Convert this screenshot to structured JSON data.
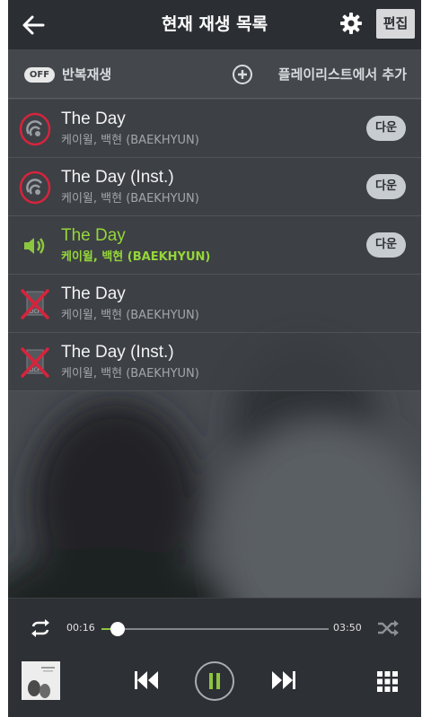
{
  "header": {
    "title": "현재 재생 목록",
    "back_icon": "back-arrow-icon",
    "settings_icon": "gear-icon",
    "edit_label": "편집"
  },
  "toolbar": {
    "repeat_toggle_state": "OFF",
    "repeat_label": "반복재생",
    "add_playlist_label": "플레이리스트에서 추가",
    "add_icon": "plus-circle-icon"
  },
  "playlist": {
    "download_label": "다운",
    "items": [
      {
        "title": "The Day",
        "artist": "케이윌, 백현 (BAEKHYUN)",
        "status_icon": "streaming-icon",
        "download": true,
        "playing": false
      },
      {
        "title": "The Day (Inst.)",
        "artist": "케이윌, 백현 (BAEKHYUN)",
        "status_icon": "streaming-icon",
        "download": true,
        "playing": false
      },
      {
        "title": "The Day",
        "artist": "케이윌, 백현 (BAEKHYUN)",
        "status_icon": "speaker-icon",
        "download": true,
        "playing": true
      },
      {
        "title": "The Day",
        "artist": "케이윌, 백현 (BAEKHYUN)",
        "status_icon": "drm-file-icon",
        "download": false,
        "playing": false
      },
      {
        "title": "The Day (Inst.)",
        "artist": "케이윌, 백현 (BAEKHYUN)",
        "status_icon": "drm-file-icon",
        "download": false,
        "playing": false
      }
    ]
  },
  "player": {
    "current_time": "00:16",
    "total_time": "03:50",
    "progress": 0.07,
    "repeat_icon": "repeat-icon",
    "shuffle_icon": "shuffle-icon",
    "prev_icon": "skip-previous-icon",
    "pause_icon": "pause-icon",
    "next_icon": "skip-next-icon",
    "menu_icon": "grid-menu-icon",
    "accent_color": "#8cc63f"
  }
}
